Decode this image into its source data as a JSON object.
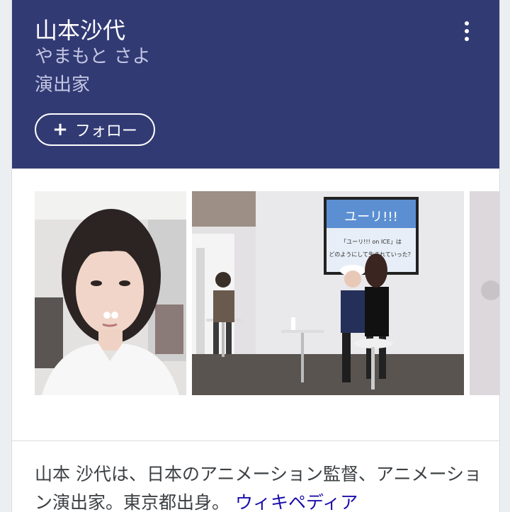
{
  "header": {
    "title": "山本沙代",
    "reading": "やまもと さよ",
    "occupation": "演出家",
    "follow_label": "フォロー",
    "follow_icon": "plus-icon",
    "more_icon": "more-vert-icon",
    "background_color": "#323a74"
  },
  "gallery": {
    "images": [
      {
        "name": "portrait-photo"
      },
      {
        "name": "event-stage-photo",
        "screen_text": "ユーリ!!! on ICE」は どのようにして生まれていった？",
        "screen_logo": "ユーリ!!!"
      },
      {
        "name": "partial-photo"
      }
    ]
  },
  "description": {
    "text": "山本 沙代は、日本のアニメーション監督、アニメーション演出家。東京都出身。",
    "source_link": "ウィキペディア"
  }
}
